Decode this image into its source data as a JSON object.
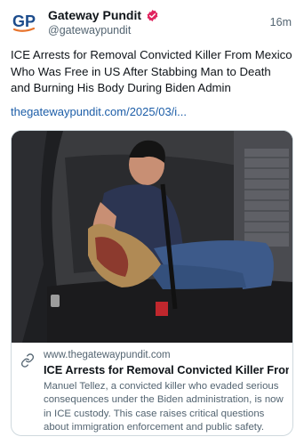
{
  "account": {
    "display_name": "Gateway Pundit",
    "handle": "@gatewaypundit",
    "avatar_text": "GP",
    "verified_icon": "verified-badge-icon"
  },
  "post": {
    "timestamp": "16m",
    "text": "ICE Arrests for Removal Convicted Killer From Mexico Who Was Free in US After Stabbing Man to Death and Burning His Body During Biden Admin",
    "link_text": "thegatewaypundit.com/2025/03/i..."
  },
  "card": {
    "domain": "www.thegatewaypundit.com",
    "title": "ICE Arrests for Removal Convicted Killer From ...",
    "description": "Manuel Tellez, a convicted killer who evaded serious consequences under the Biden administration, is now in ICE custody. This case raises critical questions about immigration enforcement and public safety.",
    "link_icon": "link-icon"
  },
  "colors": {
    "link": "#1d5ea8",
    "verified": "#e0245e",
    "muted": "#536471",
    "avatar_blue": "#1c4c8c",
    "avatar_orange": "#e8742c"
  }
}
